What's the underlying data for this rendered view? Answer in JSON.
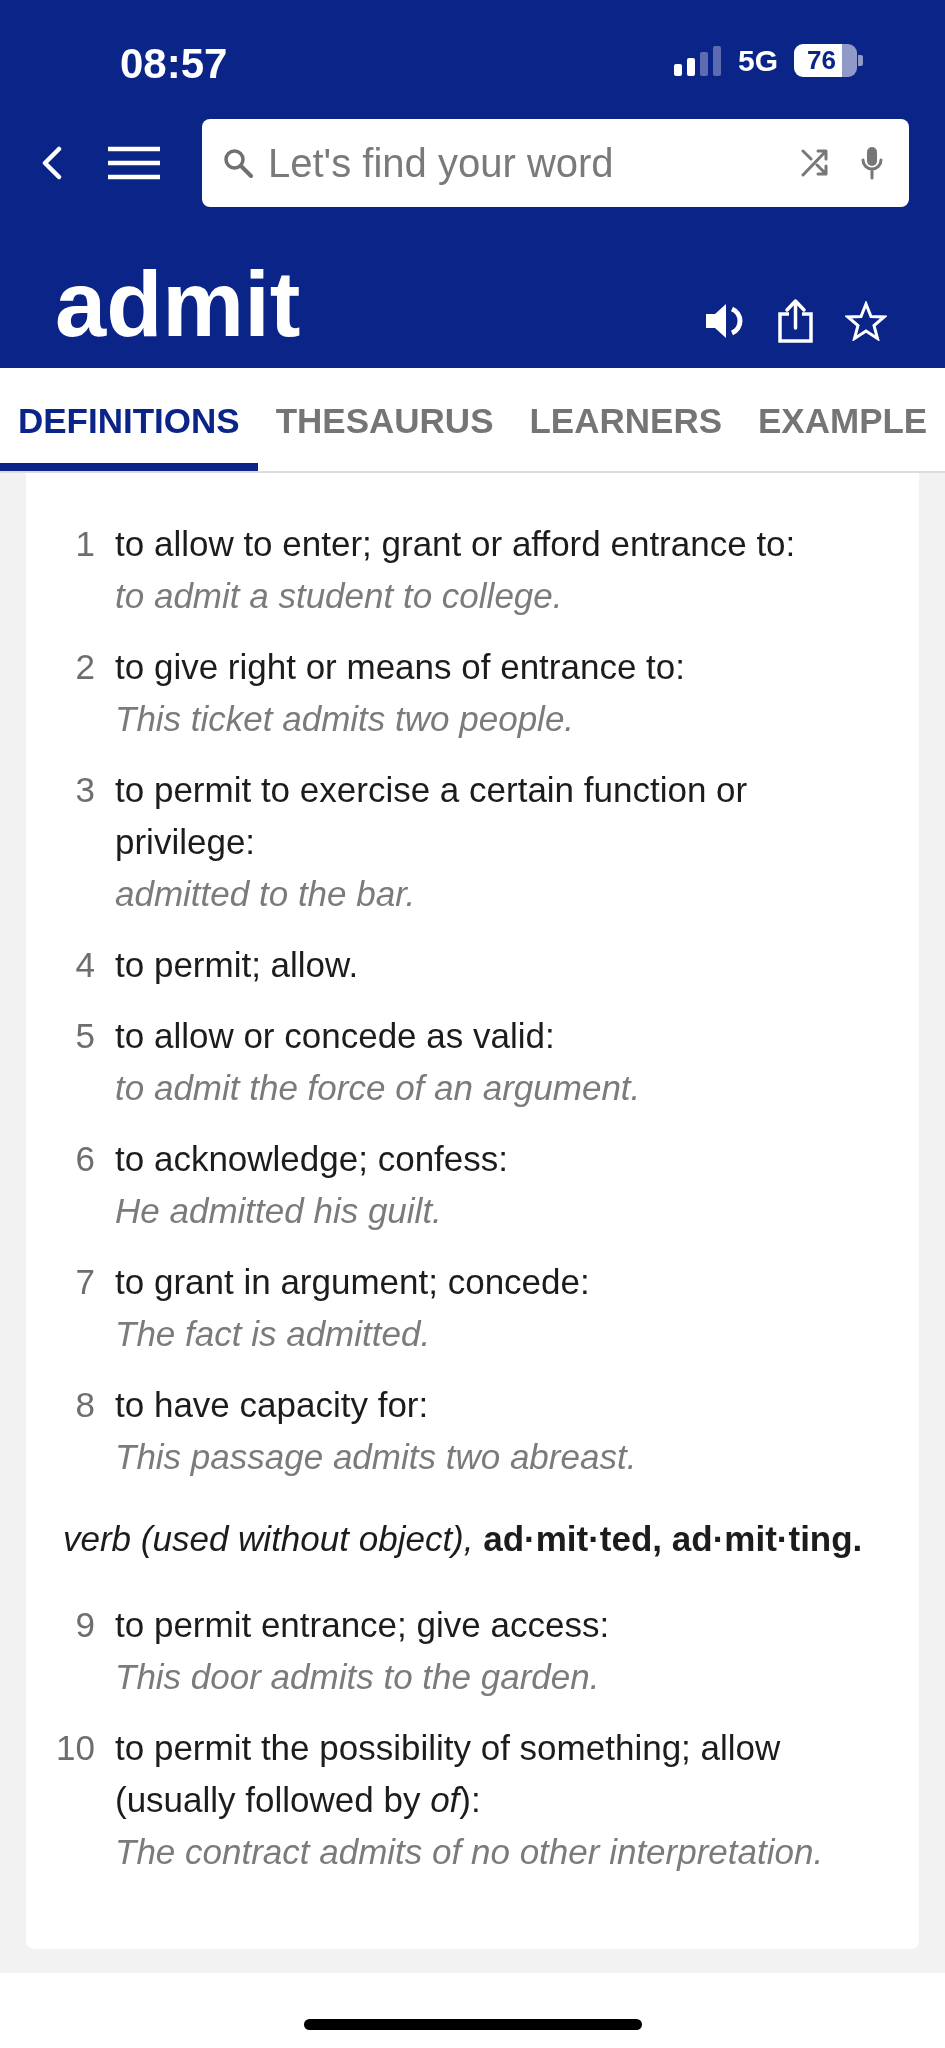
{
  "status_bar": {
    "time": "08:57",
    "network": "5G",
    "battery": "76"
  },
  "search": {
    "placeholder": "Let's find your word"
  },
  "headword": "admit",
  "tabs": [
    {
      "label": "DEFINITIONS",
      "selected": true
    },
    {
      "label": "THESAURUS",
      "selected": false
    },
    {
      "label": "LEARNERS",
      "selected": false
    },
    {
      "label": "EXAMPLE",
      "selected": false
    }
  ],
  "senses": [
    {
      "kind": "definition",
      "number": "1",
      "text": "to allow to enter; grant or afford entrance to:",
      "example": "to admit a student to college."
    },
    {
      "kind": "definition",
      "number": "2",
      "text": "to give right or means of entrance to:",
      "example": "This ticket admits two people."
    },
    {
      "kind": "definition",
      "number": "3",
      "text": "to permit to exercise a certain function or privilege:",
      "example": "admitted to the bar."
    },
    {
      "kind": "definition",
      "number": "4",
      "text": "to permit; allow."
    },
    {
      "kind": "definition",
      "number": "5",
      "text": "to allow or concede as valid:",
      "example": "to admit the force of an argument."
    },
    {
      "kind": "definition",
      "number": "6",
      "text": "to acknowledge; confess:",
      "example": "He admitted his guilt."
    },
    {
      "kind": "definition",
      "number": "7",
      "text": "to grant in argument; concede:",
      "example": "The fact is admitted."
    },
    {
      "kind": "definition",
      "number": "8",
      "text": "to have capacity for:",
      "example": "This passage admits two abreast."
    },
    {
      "kind": "part_of_speech",
      "text": "*verb (used without object),* **ad·mit·ted, ad·mit·ting.**"
    },
    {
      "kind": "definition",
      "number": "9",
      "text": "to permit entrance; give access:",
      "example": "This door admits to the garden."
    },
    {
      "kind": "definition",
      "number": "10",
      "text": "to permit the possibility of something; allow (usually followed by *of*):",
      "example": "The contract admits of no other interpretation."
    }
  ]
}
